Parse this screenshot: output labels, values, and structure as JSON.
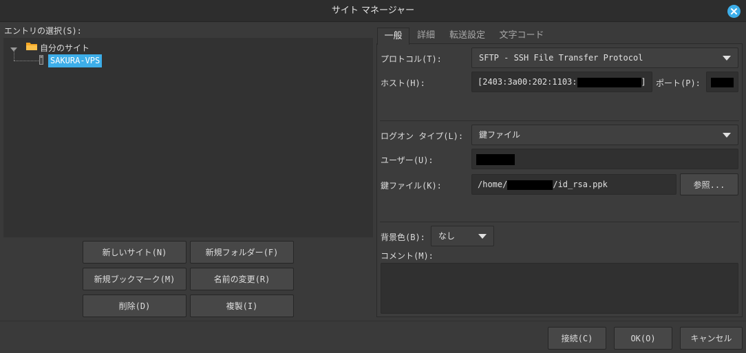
{
  "window": {
    "title": "サイト マネージャー"
  },
  "left": {
    "entry_label": "エントリの選択(S):",
    "tree": {
      "root_label": "自分のサイト",
      "child_label": "SAKURA-VPS"
    },
    "buttons": {
      "new_site": "新しいサイト(N)",
      "new_folder": "新規フォルダー(F)",
      "new_bookmark": "新規ブックマーク(M)",
      "rename": "名前の変更(R)",
      "delete": "削除(D)",
      "duplicate": "複製(I)"
    }
  },
  "tabs": [
    "一般",
    "詳細",
    "転送設定",
    "文字コード"
  ],
  "general": {
    "protocol_label": "プロトコル(T):",
    "protocol_value": "SFTP - SSH File Transfer Protocol",
    "host_label": "ホスト(H):",
    "host_prefix": "[2403:3a00:202:1103:",
    "host_suffix": "]",
    "port_label": "ポート(P):",
    "logon_label": "ログオン タイプ(L):",
    "logon_value": "鍵ファイル",
    "user_label": "ユーザー(U):",
    "keyfile_label": "鍵ファイル(K):",
    "keyfile_prefix": "/home/",
    "keyfile_suffix": "/id_rsa.ppk",
    "browse_button": "参照...",
    "bgcolor_label": "背景色(B):",
    "bgcolor_value": "なし",
    "comment_label": "コメント(M):",
    "comment_value": ""
  },
  "footer": {
    "connect": "接続(C)",
    "ok": "OK(O)",
    "cancel": "キャンセル"
  },
  "colors": {
    "accent": "#3daee9",
    "background": "#3a3a3a"
  }
}
